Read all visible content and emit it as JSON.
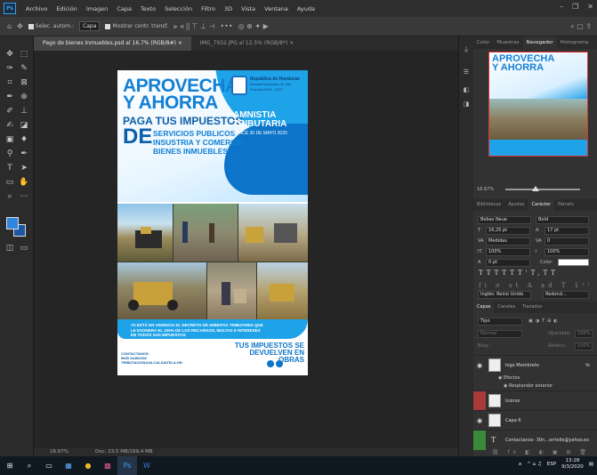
{
  "menubar": {
    "app_logo": "Ps",
    "items": [
      "Archivo",
      "Edición",
      "Imagen",
      "Capa",
      "Texto",
      "Selección",
      "Filtro",
      "3D",
      "Vista",
      "Ventana",
      "Ayuda"
    ]
  },
  "options": {
    "auto_select": "Selec. autom.:",
    "layer_select": "Capa",
    "show_transform": "Mostrar contr. transf."
  },
  "tabs": [
    {
      "label": "Pago de bienes Inmuebles.psd al 16.7% (RGB/8#) ×",
      "active": true
    },
    {
      "label": "IMG_7932.JPG al 12.5% (RGB/8*) ×",
      "active": false
    }
  ],
  "status": {
    "zoom": "16.67%",
    "doc": "Doc: 23,5 MB/169,4 MB"
  },
  "poster": {
    "line1": "APROVECHA",
    "line2": "Y AHORRA",
    "line3": "PAGA TUS IMPUESTOS",
    "de": "DE",
    "services": [
      "SERVICIOS PUBLICOS",
      "INSUSTRIA Y COMERCIO",
      "BIENES INMUEBLES"
    ],
    "republic": "República de Honduras",
    "alcaldia": "Alcaldía Municipal de Tela",
    "period": "Período 2018 - 2022",
    "amnistia1": "AMNISTIA",
    "amnistia2": "TRIBUTARIA",
    "fecha": "VENCE 30 DE MAYO 2020",
    "decree": "YA ESTÁ EN VIGENCIA EL DECRETO DE AMNISTIA TRIBUTARIA QUE LE EXONERA EL 100% DE LOS RECARGOS, MULTAS E INTERESES EN TODOS SUS IMPUESTOS",
    "obras1": "TUS IMPUESTOS SE",
    "obras2": "DEVUELVEN EN OBRAS",
    "contact1": "CONTACTANOS:",
    "contact2": "9665 2448/2302",
    "contact3": "TRIBUTACION@ALCALDIATELA.HN"
  },
  "panel": {
    "tabs": [
      "Color",
      "Muestras",
      "Navegador",
      "Histograma"
    ],
    "active_tab": "Navegador",
    "nav_zoom": "16.67%",
    "char_tabs": [
      "Bibliotecas",
      "Ajustes",
      "Carácter",
      "Párrafo"
    ],
    "font_family": "Bebas Neue",
    "font_style": "Bold",
    "font_size": "16,25 pt",
    "leading": "17 pt",
    "kerning": "Medidas",
    "tracking": "0",
    "v_scale": "100%",
    "h_scale": "100%",
    "baseline": "0 pt",
    "color_label": "Color:",
    "language": "Inglés: Reino Unido",
    "aa": "Redond..."
  },
  "layers": {
    "tabs": [
      "Capas",
      "Canales",
      "Trazados"
    ],
    "filter": "Tipo",
    "blend": "Normal",
    "opacity_label": "Opacidad:",
    "opacity": "100%",
    "lock_label": "Bloq.:",
    "fill_label": "Relleno:",
    "fill": "100%",
    "items": [
      {
        "name": "logo Membrete",
        "fx": "fx"
      },
      {
        "name": "Efectos"
      },
      {
        "name": "Resplandor exterior"
      },
      {
        "name": "Iconos"
      },
      {
        "name": "Capa 6"
      },
      {
        "name": "Contactanos- 30n...orrielle@yahoo.es"
      }
    ]
  },
  "taskbar": {
    "lang": "ESP",
    "time": "13:28",
    "date": "9/3/2020"
  }
}
